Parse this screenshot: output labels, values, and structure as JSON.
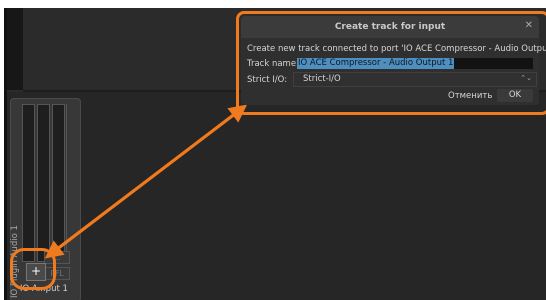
{
  "dialog": {
    "title": "Create track for input",
    "close_glyph": "✕",
    "message": "Create new track connected to port 'IO ACE Compressor - Audio Output 1'",
    "track_name_label": "Track name:",
    "track_name_value": "IO ACE Compressor - Audio Output 1",
    "strict_io_label": "Strict I/O:",
    "strict_io_value": "Strict-I/O",
    "select_arrow_glyph": "⌃⌄",
    "cancel_label": "Отменить",
    "ok_label": "OK"
  },
  "mixer_strip": {
    "vertical_label": "IO Plugin Audio 1",
    "top_button_label": "...",
    "pfl_label": "PFL",
    "add_button_label": "+",
    "output_label": "IO A...put 1"
  },
  "annotation": {
    "color": "#f07a1e",
    "arrow_icon": "double-headed-arrow"
  }
}
